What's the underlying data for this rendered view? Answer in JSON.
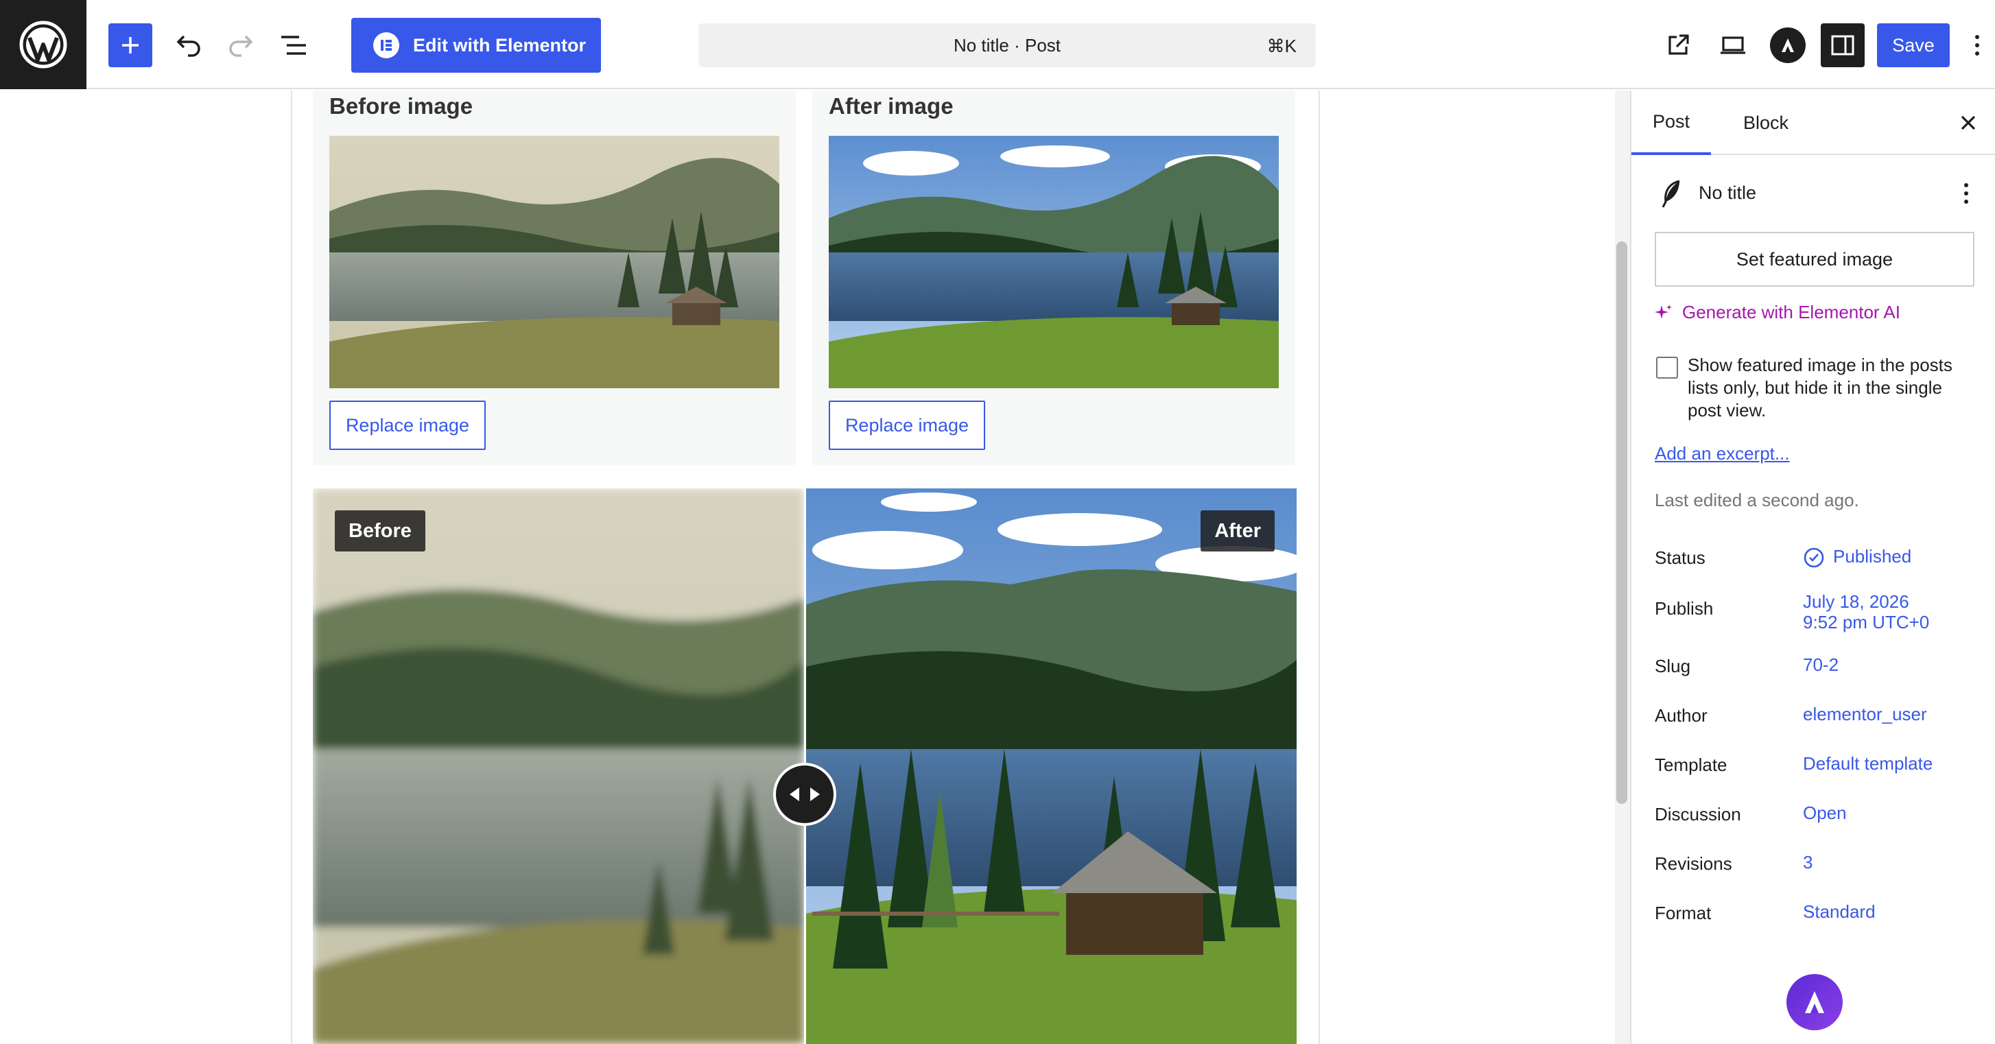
{
  "topbar": {
    "elementor_label": "Edit with Elementor",
    "command_title": "No title · Post",
    "command_shortcut": "⌘K",
    "save_label": "Save",
    "icons": [
      "wordpress-icon",
      "plus-icon",
      "undo-icon",
      "redo-icon",
      "document-overview-icon",
      "external-link-icon",
      "desktop-preview-icon",
      "astra-icon",
      "sidebar-toggle-icon",
      "more-vertical-icon"
    ]
  },
  "editor": {
    "before_heading": "Before image",
    "after_heading": "After image",
    "replace_label": "Replace image",
    "compare_before_tag": "Before",
    "compare_after_tag": "After"
  },
  "sidebar": {
    "tabs": [
      "Post",
      "Block"
    ],
    "post_title": "No title",
    "featured_image_button": "Set featured image",
    "generate_ai": "Generate with Elementor AI",
    "featured_checkbox_label": "Show featured image in the posts lists only, but hide it in the single post view.",
    "excerpt_link": "Add an excerpt...",
    "last_edited": "Last edited a second ago.",
    "meta": [
      {
        "label": "Status",
        "value": "Published"
      },
      {
        "label": "Publish",
        "value": "July 18, 2026\n9:52 pm UTC+0"
      },
      {
        "label": "Slug",
        "value": "70-2"
      },
      {
        "label": "Author",
        "value": "elementor_user"
      },
      {
        "label": "Template",
        "value": "Default template"
      },
      {
        "label": "Discussion",
        "value": "Open"
      },
      {
        "label": "Revisions",
        "value": "3"
      },
      {
        "label": "Format",
        "value": "Standard"
      }
    ]
  },
  "colors": {
    "accent": "#3858e9",
    "elementor_ai": "#a516b0",
    "dark": "#1e1e1e"
  }
}
